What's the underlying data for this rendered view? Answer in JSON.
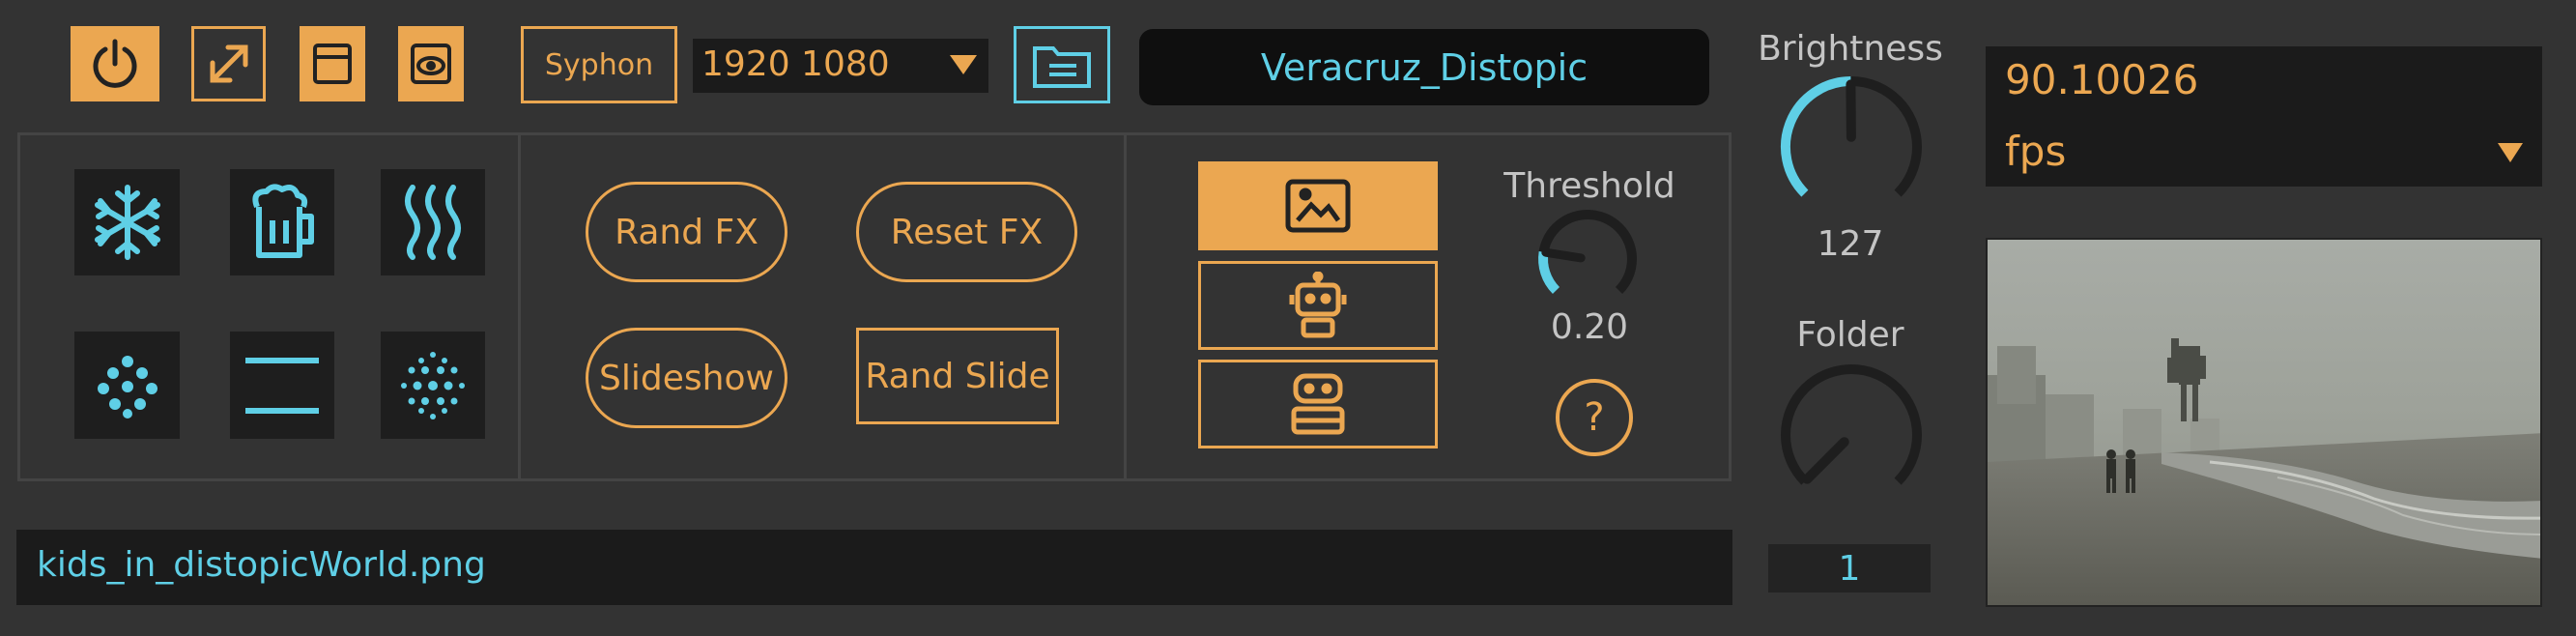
{
  "toolbar": {
    "power_icon": "power-icon",
    "fullscreen_icon": "expand-arrows-icon",
    "window_icon": "window-icon",
    "preview_icon": "eye-icon",
    "syphon_label": "Syphon",
    "resolution_value": "1920 1080",
    "folder_icon": "folder-icon",
    "source_name": "Veracruz_Distopic"
  },
  "fx": {
    "icons": [
      "snowflake-icon",
      "beer-mug-icon",
      "heat-waves-icon",
      "dots-cluster-icon",
      "horizontal-lines-icon",
      "dot-grid-icon"
    ]
  },
  "buttons": {
    "rand_fx": "Rand FX",
    "reset_fx": "Reset FX",
    "slideshow": "Slideshow",
    "rand_slide": "Rand Slide"
  },
  "modes": {
    "items": [
      "image-icon",
      "robot-icon",
      "robot-head-icon"
    ],
    "selected": "image-icon"
  },
  "threshold": {
    "label": "Threshold",
    "value_text": "0.20",
    "value": 0.2
  },
  "help_label": "?",
  "brightness": {
    "label": "Brightness",
    "value_text": "127",
    "value": 127,
    "max": 255
  },
  "folder": {
    "label": "Folder",
    "value_text": "1"
  },
  "fps": {
    "value": "90.10026",
    "unit": "fps"
  },
  "filename": "kids_in_distopicWorld.png",
  "colors": {
    "accent": "#eba751",
    "cyan": "#5fcfe6",
    "background": "#333333",
    "panel": "#1b1b1b"
  }
}
